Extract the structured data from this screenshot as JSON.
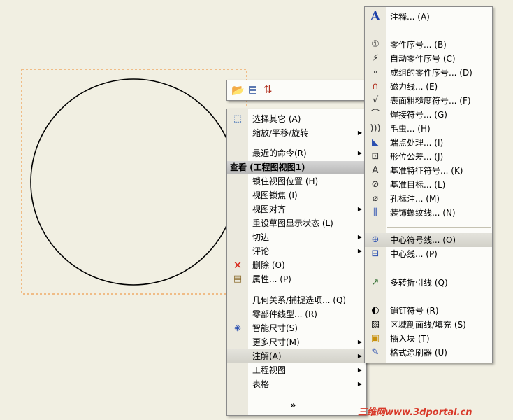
{
  "toolbar": {
    "icons": [
      "pin-folder-icon",
      "grid-icon",
      "swap-icon"
    ]
  },
  "context_menu": {
    "items_top": [
      {
        "label": "选择其它 (A)",
        "icon": "select-other-icon"
      },
      {
        "label": "缩放/平移/旋转",
        "submenu": true
      },
      {
        "label": "最近的命令(R)",
        "submenu": true
      }
    ],
    "header": "查看 (工程图视图1)",
    "view_items": [
      {
        "label": "锁住视图位置 (H)"
      },
      {
        "label": "视图锁焦 (I)"
      },
      {
        "label": "视图对齐",
        "submenu": true
      },
      {
        "label": "重设草图显示状态 (L)"
      },
      {
        "label": "切边",
        "submenu": true
      },
      {
        "label": "评论",
        "submenu": true
      },
      {
        "label": "删除 (O)",
        "icon": "delete-icon"
      },
      {
        "label": "属性... (P)",
        "icon": "properties-icon"
      }
    ],
    "bottom_items": [
      {
        "label": "几何关系/捕捉选项... (Q)"
      },
      {
        "label": "零部件线型... (R)"
      },
      {
        "label": "智能尺寸(S)",
        "icon": "smart-dimension-icon"
      },
      {
        "label": "更多尺寸(M)",
        "submenu": true
      },
      {
        "label": "注解(A)",
        "submenu": true,
        "highlighted": true
      },
      {
        "label": "工程视图",
        "submenu": true
      },
      {
        "label": "表格",
        "submenu": true
      }
    ],
    "expand_glyph": "»"
  },
  "annotation_menu": {
    "items": [
      {
        "label": "注释... (A)",
        "icon": "note-icon",
        "glyph": "A"
      },
      {
        "label": "零件序号... (B)",
        "icon": "balloon-icon",
        "glyph": "①"
      },
      {
        "label": "自动零件序号 (C)",
        "icon": "auto-balloon-icon",
        "glyph": "⚡"
      },
      {
        "label": "成组的零件序号... (D)",
        "icon": "stacked-balloon-icon",
        "glyph": "∘"
      },
      {
        "label": "磁力线... (E)",
        "icon": "magnetic-line-icon",
        "glyph": "∩"
      },
      {
        "label": "表面粗糙度符号... (F)",
        "icon": "surface-finish-icon",
        "glyph": "√"
      },
      {
        "label": "焊接符号... (G)",
        "icon": "weld-symbol-icon",
        "glyph": "⌒"
      },
      {
        "label": "毛虫... (H)",
        "icon": "caterpillar-icon",
        "glyph": ")))"
      },
      {
        "label": "端点处理... (I)",
        "icon": "end-treatment-icon",
        "glyph": "◣"
      },
      {
        "label": "形位公差... (J)",
        "icon": "geometric-tolerance-icon",
        "glyph": "⊡"
      },
      {
        "label": "基准特征符号... (K)",
        "icon": "datum-feature-icon",
        "glyph": "A"
      },
      {
        "label": "基准目标... (L)",
        "icon": "datum-target-icon",
        "glyph": "⊘"
      },
      {
        "label": "孔标注... (M)",
        "icon": "hole-callout-icon",
        "glyph": "⌀"
      },
      {
        "label": "装饰螺纹线... (N)",
        "icon": "cosmetic-thread-icon",
        "glyph": "⫼"
      },
      {
        "label": "中心符号线... (O)",
        "icon": "center-mark-icon",
        "glyph": "⊕",
        "highlighted": true
      },
      {
        "label": "中心线... (P)",
        "icon": "centerline-icon",
        "glyph": "⊟"
      },
      {
        "label": "多转折引线 (Q)",
        "icon": "multi-jog-leader-icon",
        "glyph": "↗"
      },
      {
        "label": "销钉符号 (R)",
        "icon": "dowel-pin-icon",
        "glyph": "◐"
      },
      {
        "label": "区域剖面线/填充 (S)",
        "icon": "area-hatch-icon",
        "glyph": "▨"
      },
      {
        "label": "插入块 (T)",
        "icon": "insert-block-icon",
        "glyph": "▣"
      },
      {
        "label": "格式涂刷器 (U)",
        "icon": "format-painter-icon",
        "glyph": "✎"
      }
    ]
  },
  "watermark": "三维网www.3dportal.cn",
  "colors": {
    "background": "#f1efe2",
    "dashed_border": "#f08a2a",
    "highlight": "#d6d5cd"
  }
}
